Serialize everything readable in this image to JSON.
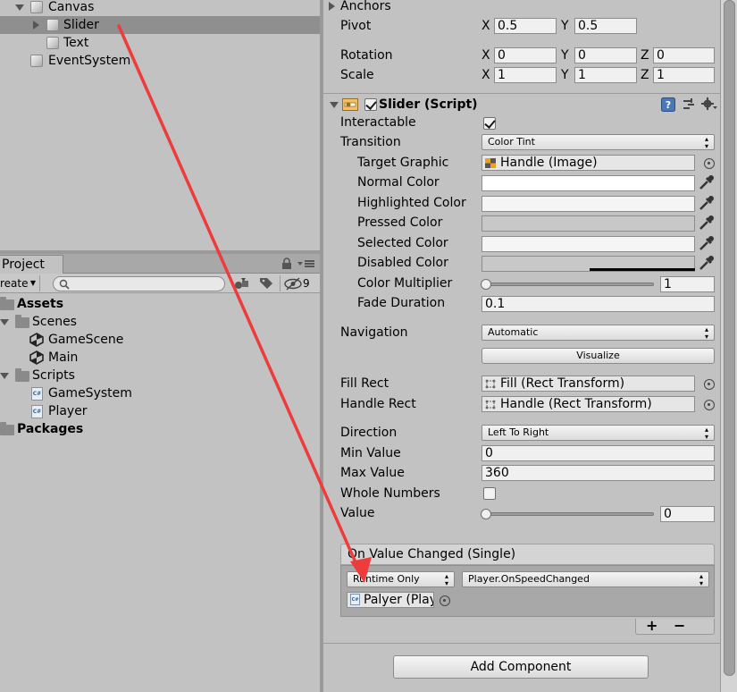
{
  "hierarchy": {
    "items": [
      {
        "label": "Canvas"
      },
      {
        "label": "Slider"
      },
      {
        "label": "Text"
      },
      {
        "label": "EventSystem"
      }
    ]
  },
  "project": {
    "tab_label": "Project",
    "create_label": "reate",
    "hidden_count": "9",
    "tree": [
      {
        "label": "Assets"
      },
      {
        "label": "Scenes"
      },
      {
        "label": "GameScene"
      },
      {
        "label": "Main"
      },
      {
        "label": "Scripts"
      },
      {
        "label": "GameSystem"
      },
      {
        "label": "Player"
      },
      {
        "label": "Packages"
      }
    ]
  },
  "inspector": {
    "anchors_label": "Anchors",
    "pivot": {
      "label": "Pivot",
      "x": "0.5",
      "y": "0.5"
    },
    "rotation": {
      "label": "Rotation",
      "x": "0",
      "y": "0",
      "z": "0"
    },
    "scale": {
      "label": "Scale",
      "x": "1",
      "y": "1",
      "z": "1"
    },
    "axes": {
      "x": "X",
      "y": "Y",
      "z": "Z"
    },
    "slider_component": {
      "title": "Slider (Script)",
      "interactable_label": "Interactable",
      "interactable": true,
      "transition_label": "Transition",
      "transition_value": "Color Tint",
      "target_graphic_label": "Target Graphic",
      "target_graphic_value": "Handle (Image)",
      "normal_color_label": "Normal Color",
      "highlighted_color_label": "Highlighted Color",
      "pressed_color_label": "Pressed Color",
      "selected_color_label": "Selected Color",
      "disabled_color_label": "Disabled Color",
      "color_multiplier_label": "Color Multiplier",
      "color_multiplier_value": "1",
      "color_multiplier_level": 0,
      "fade_duration_label": "Fade Duration",
      "fade_duration_value": "0.1",
      "navigation_label": "Navigation",
      "navigation_value": "Automatic",
      "visualize_label": "Visualize",
      "fill_rect_label": "Fill Rect",
      "fill_rect_value": "Fill (Rect Transform)",
      "handle_rect_label": "Handle Rect",
      "handle_rect_value": "Handle (Rect Transform)",
      "direction_label": "Direction",
      "direction_value": "Left To Right",
      "min_value_label": "Min Value",
      "min_value": "0",
      "max_value_label": "Max Value",
      "max_value": "360",
      "whole_numbers_label": "Whole Numbers",
      "whole_numbers": false,
      "value_label": "Value",
      "value": "0",
      "value_level": 0
    },
    "on_value_changed": {
      "header": "On Value Changed (Single)",
      "runtime_value": "Runtime Only",
      "function_value": "Player.OnSpeedChanged",
      "object_value": "Palyer (Play",
      "add_label": "+",
      "remove_label": "−"
    },
    "add_component_label": "Add Component"
  },
  "colors": {
    "normal": "#ffffff",
    "highlighted": "#f5f5f5",
    "pressed": "#c8c8c8",
    "selected": "#f5f5f5",
    "disabled": "#c8c8c8",
    "arrow": "#ee3b3b"
  }
}
